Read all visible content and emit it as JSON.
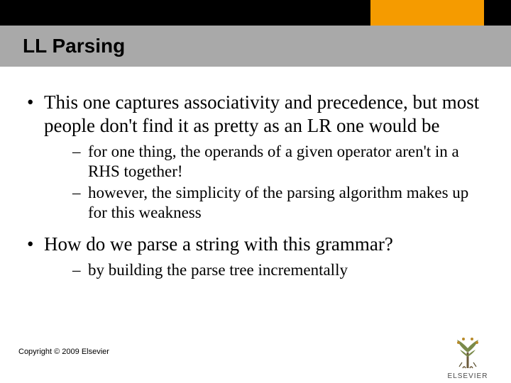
{
  "title": "LL Parsing",
  "bullets": [
    {
      "text": "This one captures associativity and precedence, but most people don't find it as pretty as an LR one would be",
      "sub": [
        "for one thing, the operands of a given operator aren't in a RHS together!",
        "however, the simplicity of the parsing algorithm makes up for this weakness"
      ]
    },
    {
      "text": "How do we parse a string with this grammar?",
      "sub": [
        "by building the parse tree incrementally"
      ]
    }
  ],
  "copyright": "Copyright © 2009 Elsevier",
  "logo_text": "ELSEVIER"
}
